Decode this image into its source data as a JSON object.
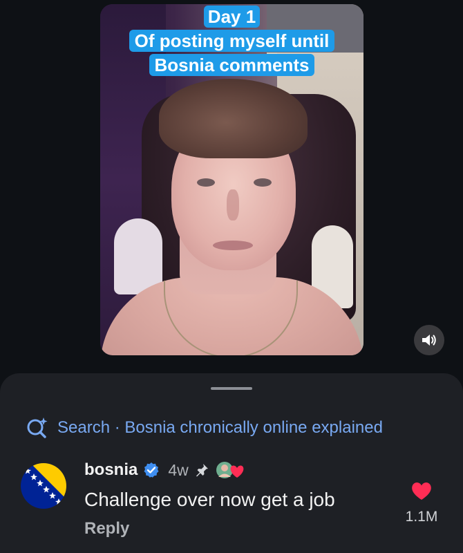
{
  "video": {
    "caption_day": "Day 1",
    "caption_line1": "Of posting myself until",
    "caption_line2": "Bosnia comments",
    "volume_icon": "speaker-sound-icon"
  },
  "sheet": {
    "search_prefix": "Search",
    "search_separator": " · ",
    "search_query": "Bosnia chronically online explained"
  },
  "comment": {
    "username": "bosnia",
    "verified_icon": "verified-badge-icon",
    "time_ago": "4w",
    "pinned_icon": "pin-icon",
    "text": "Challenge over now get a job",
    "reply_label": "Reply",
    "like_count": "1.1M"
  },
  "colors": {
    "accent_blue": "#79a9f2",
    "caption_blue": "#1e9be8",
    "like_red": "#ff2d55",
    "sheet_bg": "#1e2025"
  }
}
